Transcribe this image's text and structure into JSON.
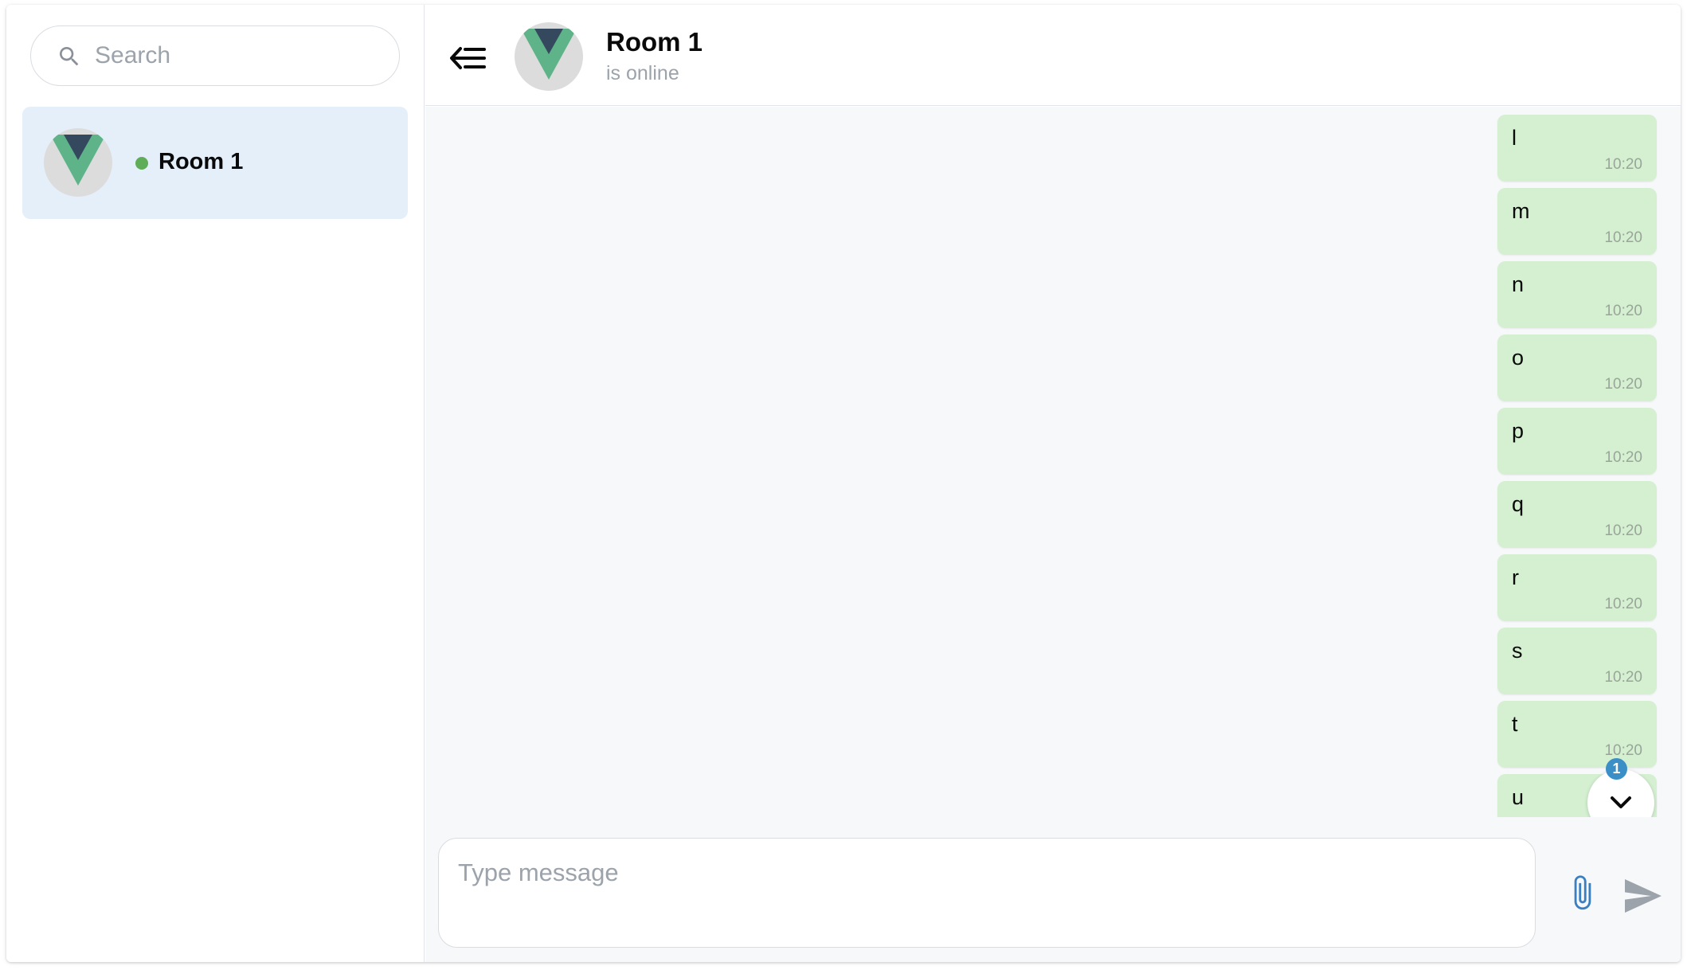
{
  "sidebar": {
    "search": {
      "placeholder": "Search",
      "value": ""
    },
    "rooms": [
      {
        "name": "Room 1",
        "status": "online",
        "avatar_icon": "vue-logo-icon"
      }
    ]
  },
  "header": {
    "title": "Room 1",
    "status": "is online"
  },
  "messages": [
    {
      "text": "l",
      "time": "10:20"
    },
    {
      "text": "m",
      "time": "10:20"
    },
    {
      "text": "n",
      "time": "10:20"
    },
    {
      "text": "o",
      "time": "10:20"
    },
    {
      "text": "p",
      "time": "10:20"
    },
    {
      "text": "q",
      "time": "10:20"
    },
    {
      "text": "r",
      "time": "10:20"
    },
    {
      "text": "s",
      "time": "10:20"
    },
    {
      "text": "t",
      "time": "10:20"
    },
    {
      "text": "u",
      "time": ""
    }
  ],
  "scroll_down": {
    "unread_count": "1"
  },
  "composer": {
    "placeholder": "Type message",
    "value": ""
  },
  "colors": {
    "accent": "#3a8fc7",
    "bubble": "#d4f0d1",
    "selected_room": "#e5effa",
    "online": "#5fad56"
  }
}
